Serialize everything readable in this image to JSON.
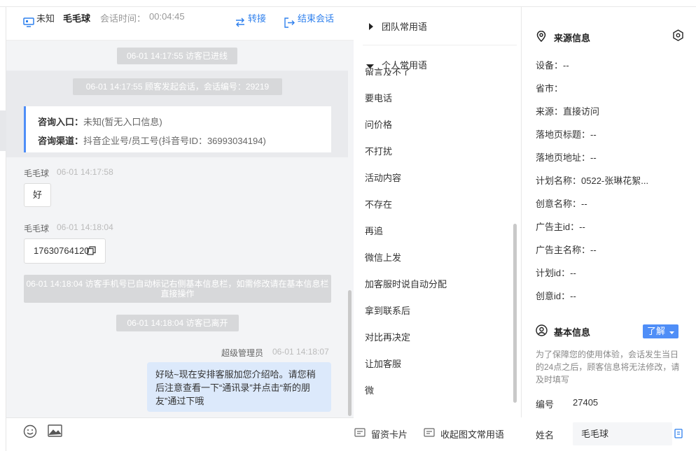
{
  "header": {
    "status": "未知",
    "visitor_name": "毛毛球",
    "session_time_label": "会话时间：",
    "session_time": "00:04:45",
    "transfer_label": "转接",
    "end_label": "结束会话"
  },
  "chat": {
    "system_msgs": [
      "06-01 14:17:55 访客已进线",
      "06-01 14:17:55 顾客发起会话，会话编号：29219",
      "06-01 14:18:04 访客手机号已自动标记右侧基本信息栏，如需修改请在基本信息栏直接操作",
      "06-01 14:18:04 访客已离开"
    ],
    "consult_entry_label": "咨询入口：",
    "consult_entry_value": "未知(暂无入口信息)",
    "consult_channel_label": "咨询渠道：",
    "consult_channel_value": "抖音企业号/员工号(抖音号ID：36993034194)",
    "messages": [
      {
        "name": "毛毛球",
        "time": "06-01 14:17:58",
        "text": "好"
      },
      {
        "name": "毛毛球",
        "time": "06-01 14:18:04",
        "text": "17630764120"
      },
      {
        "name": "超级管理员",
        "time": "06-01 14:18:07",
        "text": "好哒~现在安排客服加您介绍哈。请您稍后注意查看一下“通讯录”并点击“新的朋友”通过下哦"
      }
    ]
  },
  "footer": {
    "card_label": "留资卡片",
    "collapse_label": "收起图文常用语"
  },
  "phrases": {
    "team_label": "团队常用语",
    "personal_label": "个人常用语",
    "clipped_item": "留言及不了",
    "items": [
      "要电话",
      "问价格",
      "不打扰",
      "活动内容",
      "不存在",
      "再追",
      "微信上发",
      "加客服时说自动分配",
      "拿到联系后",
      "对比再决定",
      "让加客服",
      "微"
    ]
  },
  "source_info": {
    "title": "来源信息",
    "rows": [
      "设备：--",
      "省市：",
      "来源：直接访问",
      "落地页标题：--",
      "落地页地址：--",
      "计划名称：0522-张琳花絮...",
      "创意名称：--",
      "广告主id：--",
      "广告主名称：--",
      "计划id：--",
      "创意id：--"
    ]
  },
  "basic_info": {
    "title": "基本信息",
    "learn_label": "了解",
    "hint": "为了保障您的使用体验，会话发生当日的24点之后，顾客信息将无法修改，请及时填写",
    "number_label": "编号",
    "number_value": "27405",
    "name_label": "姓名",
    "name_value": "毛毛球"
  },
  "colors": {
    "accent": "#2f80ed",
    "info_card_border": "#4f8ef7",
    "agent_bubble": "#dce9fb",
    "system_pill": "#d7d8da"
  }
}
